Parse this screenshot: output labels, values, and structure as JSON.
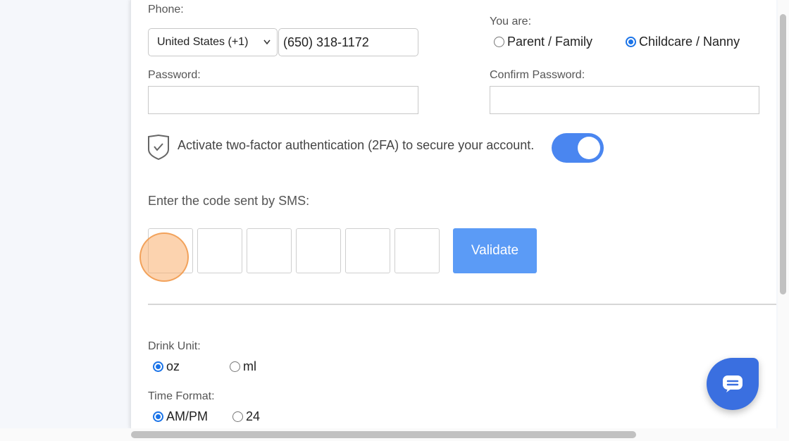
{
  "form": {
    "phone_label": "Phone:",
    "country_value": "United States (+1)",
    "phone_value": "(650) 318-1172",
    "you_are_label": "You are:",
    "role_options": [
      {
        "label": "Parent / Family",
        "selected": false
      },
      {
        "label": "Childcare / Nanny",
        "selected": true
      }
    ],
    "password_label": "Password:",
    "confirm_password_label": "Confirm Password:",
    "twofa_text": "Activate two-factor authentication (2FA) to secure your account.",
    "twofa_enabled": true,
    "sms_code_label": "Enter the code sent by SMS:",
    "code_digits": [
      "",
      "",
      "",
      "",
      "",
      ""
    ],
    "validate_label": "Validate",
    "drink_unit_label": "Drink Unit:",
    "drink_unit_options": [
      {
        "label": "oz",
        "selected": true
      },
      {
        "label": "ml",
        "selected": false
      }
    ],
    "time_format_label": "Time Format:",
    "time_format_options": [
      {
        "label": "AM/PM",
        "selected": true
      },
      {
        "label": "24",
        "selected": false
      }
    ]
  },
  "colors": {
    "accent": "#1a73e8",
    "toggle_on": "#4a86f0",
    "validate_button": "#5b9bf6",
    "chat_button": "#3a6fe0"
  },
  "icons": {
    "shield": "shield-check-icon",
    "chevron": "chevron-down-icon",
    "chat": "chat-bubble-icon"
  }
}
